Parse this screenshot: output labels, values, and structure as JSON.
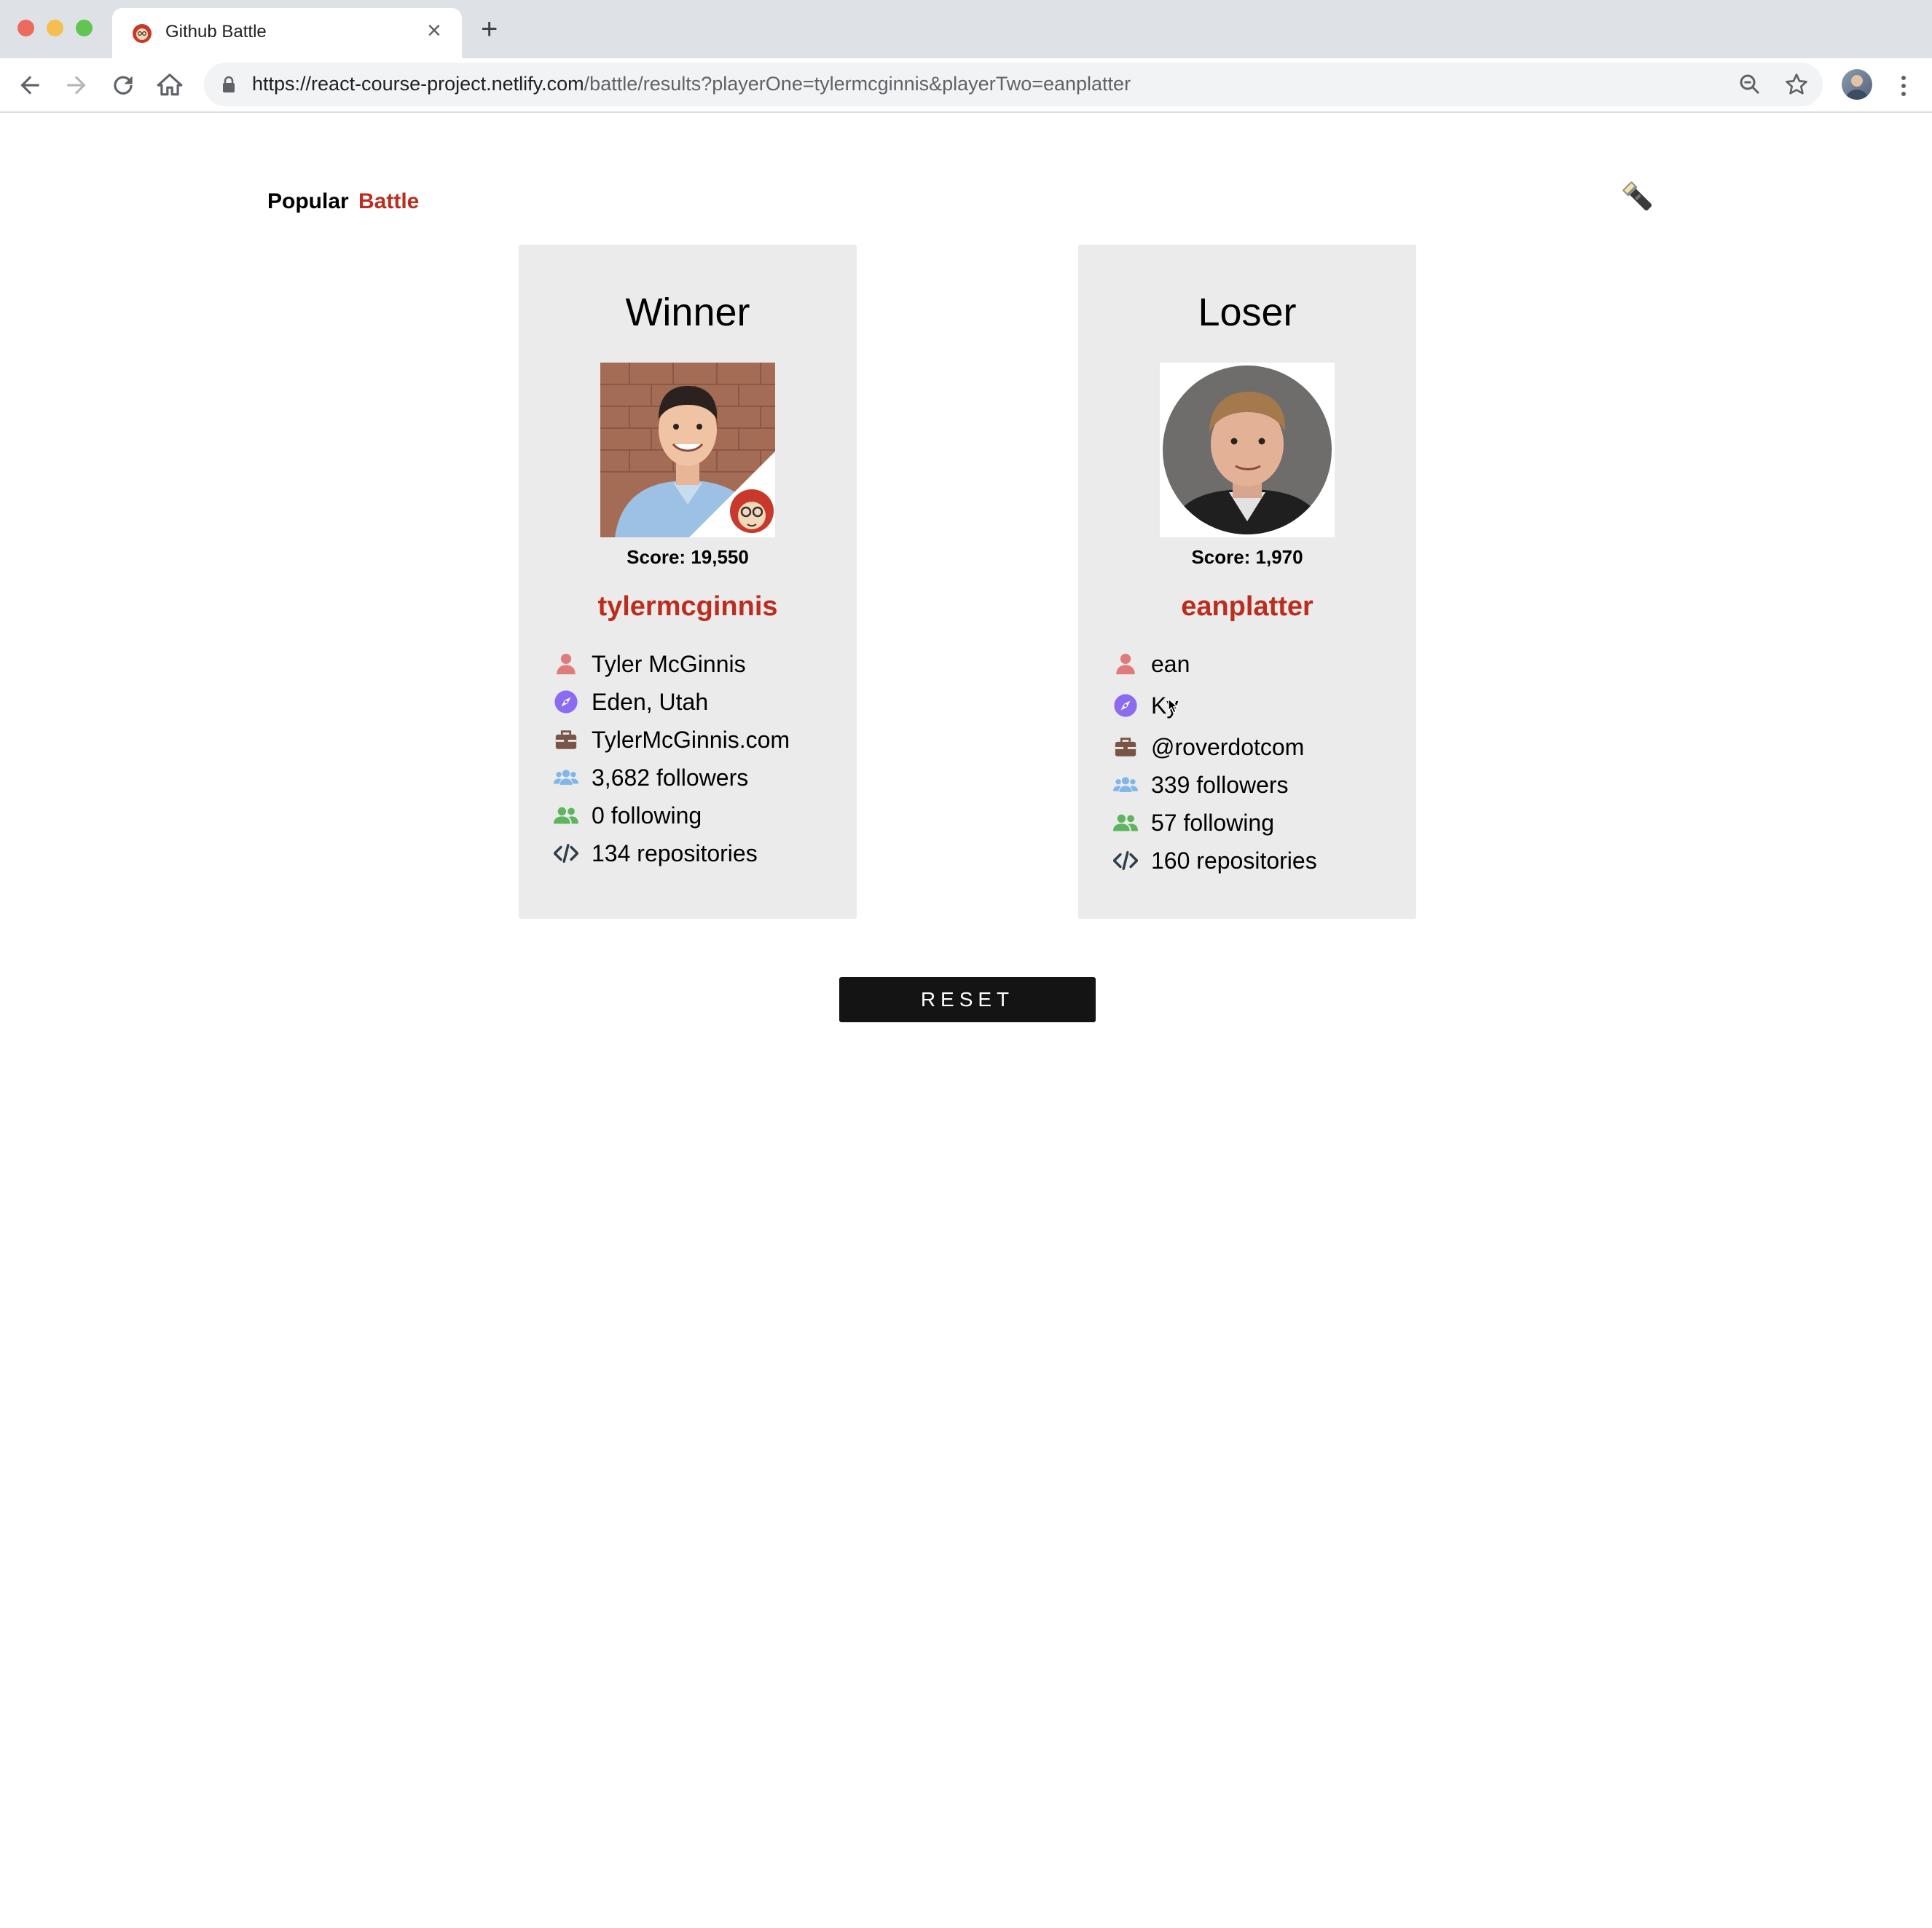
{
  "browser": {
    "tab_title": "Github Battle",
    "url_host": "https://react-course-project.netlify.com",
    "url_path": "/battle/results?playerOne=tylermcginnis&playerTwo=eanplatter"
  },
  "nav": {
    "popular": "Popular",
    "battle": "Battle"
  },
  "players": [
    {
      "header": "Winner",
      "score": "Score: 19,550",
      "login": "tylermcginnis",
      "name": "Tyler McGinnis",
      "location": "Eden, Utah",
      "company": "TylerMcGinnis.com",
      "followers": "3,682 followers",
      "following": "0 following",
      "repositories": "134 repositories"
    },
    {
      "header": "Loser",
      "score": "Score: 1,970",
      "login": "eanplatter",
      "name": "ean",
      "location": "Ky",
      "company": "@roverdotcom",
      "followers": "339 followers",
      "following": "57 following",
      "repositories": "160 repositories"
    }
  ],
  "reset_label": "RESET",
  "colors": {
    "accent": "#bb2e1f",
    "card_bg": "#ebebeb",
    "user_icon": "#e07b7b",
    "compass_icon": "#8b6cf0",
    "briefcase_icon": "#795548",
    "users_icon": "#81b6e9",
    "following_icon": "#5fb55f",
    "code_icon": "#2f3e4b"
  }
}
